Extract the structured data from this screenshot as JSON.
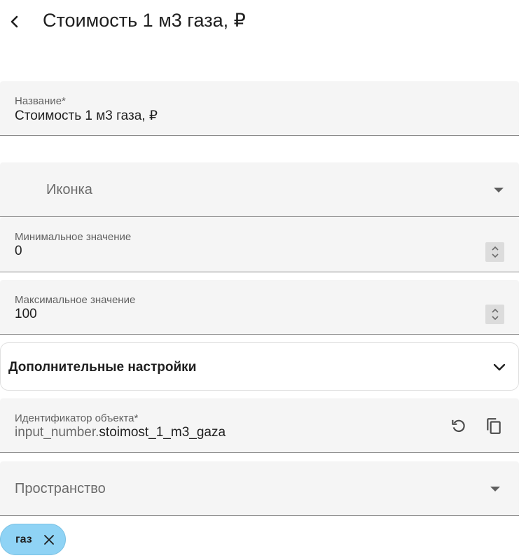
{
  "header": {
    "title": "Стоимость 1 м3 газа, ₽"
  },
  "form": {
    "name": {
      "label": "Название*",
      "value": "Стоимость 1 м3 газа, ₽"
    },
    "icon": {
      "placeholder": "Иконка"
    },
    "min": {
      "label": "Минимальное значение",
      "value": "0"
    },
    "max": {
      "label": "Максимальное значение",
      "value": "100"
    },
    "advanced": {
      "title": "Дополнительные настройки"
    },
    "entity_id": {
      "label": "Идентификатор объекта*",
      "prefix": "input_number.",
      "value": "stoimost_1_m3_gaza"
    },
    "area": {
      "placeholder": "Пространство"
    },
    "labels": [
      {
        "text": "газ",
        "color": "#8fd3f5"
      }
    ]
  },
  "icons": {
    "back": "chevron-left-icon",
    "dropdown": "dropdown-arrow-icon",
    "spinner": "spinner-arrows-icon",
    "expand": "chevron-down-icon",
    "regenerate": "refresh-icon",
    "copy": "copy-icon",
    "remove": "close-icon"
  }
}
